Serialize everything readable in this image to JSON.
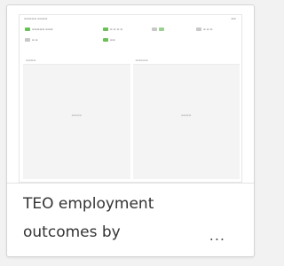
{
  "card": {
    "title_line1": "TEO employment",
    "title_line2": "outcomes by",
    "more_label": "..."
  },
  "colors": {
    "accent_green": "#6bbf59",
    "light_green": "#9ccf92",
    "pane_background": "#f4f4f4",
    "title_text": "#333333"
  }
}
